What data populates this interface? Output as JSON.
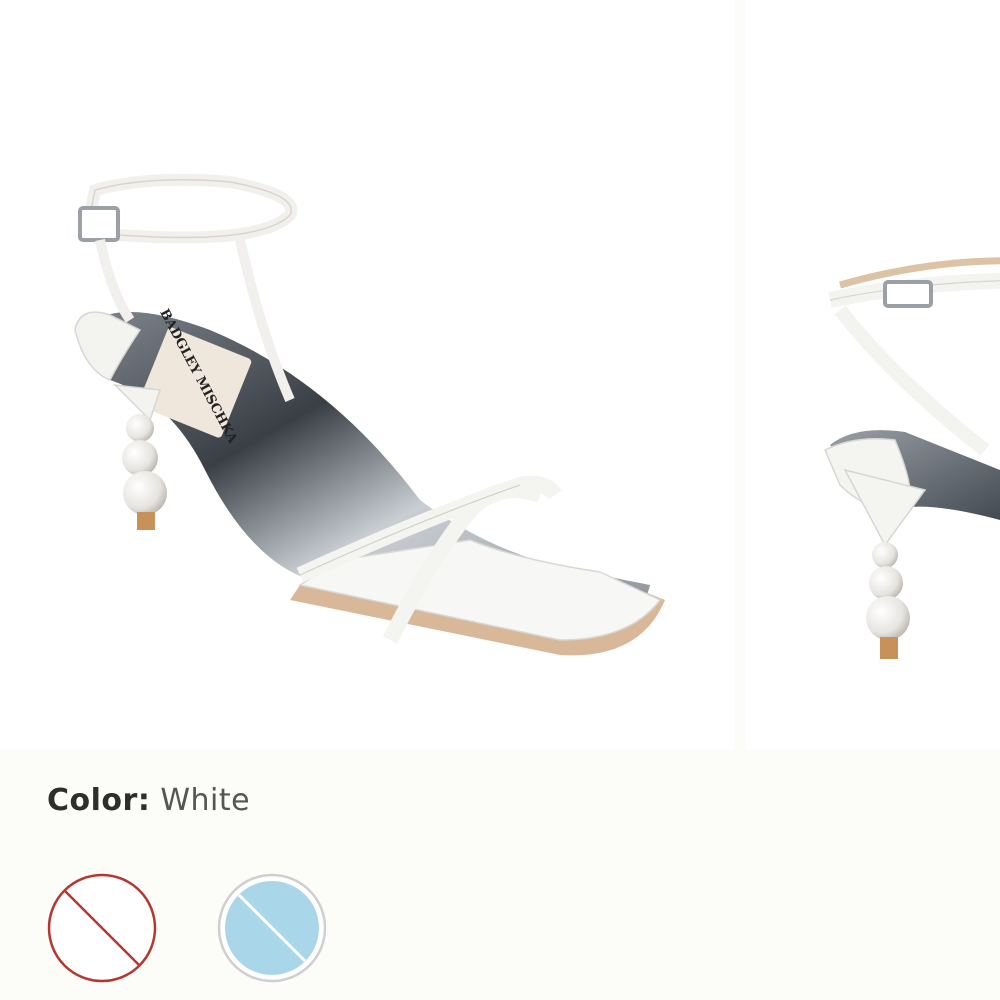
{
  "product": {
    "images": [
      {
        "alt": "Sandal side view",
        "icon": "sandal-front-three-quarter"
      },
      {
        "alt": "Sandal back view",
        "icon": "sandal-rear-three-quarter"
      }
    ],
    "brand_mark": "BADGLEY MISCHKA"
  },
  "color_selector": {
    "label": "Color:",
    "selected_value": "White",
    "swatches": [
      {
        "name": "white",
        "fill": "#ffffff",
        "ring": "#b5372f",
        "unavailable": true
      },
      {
        "name": "light-blue",
        "fill": "#a9d6e8",
        "ring": "#cfcfcf",
        "unavailable": true
      }
    ]
  }
}
